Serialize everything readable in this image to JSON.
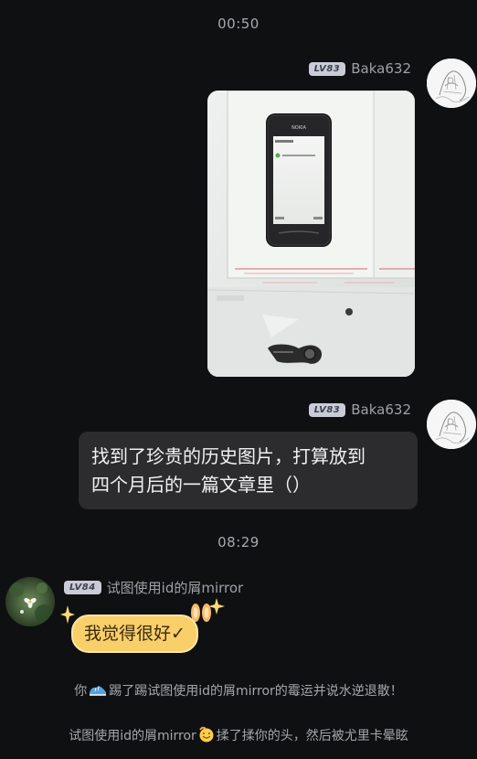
{
  "timestamps": [
    "00:50",
    "08:29"
  ],
  "messages": [
    {
      "sender": "Baka632",
      "level": "LV83",
      "kind": "image"
    },
    {
      "sender": "Baka632",
      "level": "LV83",
      "kind": "text",
      "lines": [
        "找到了珍贵的历史图片，打算放到",
        "四个月后的一篇文章里（）"
      ]
    },
    {
      "sender": "试图使用id的屑mirror",
      "level": "LV84",
      "kind": "text",
      "text": "我觉得很好✓"
    }
  ],
  "system_notices": [
    {
      "before": "你",
      "after": "踢了踢试图使用id的屑mirror的霉运并说水逆退散！",
      "icon": "shoe-icon"
    },
    {
      "before": "试图使用id的屑mirror",
      "after": "揉了揉你的头，然后被尤里卡晕眩",
      "icon": "emoji-face-icon"
    }
  ],
  "photo": {
    "phone_brand": "NOKIA"
  },
  "colors": {
    "background": "#0f1012",
    "bubble": "#2c2c2f",
    "sticker_bubble": "#f9cf6a",
    "badge": "#c9ccd6"
  }
}
